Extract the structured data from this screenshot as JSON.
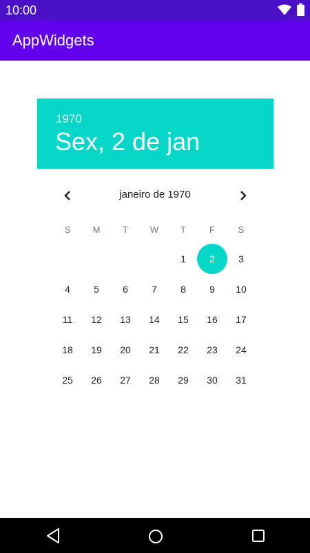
{
  "status_bar": {
    "time": "10:00",
    "icons": [
      "wifi-icon",
      "battery-icon"
    ]
  },
  "app_bar": {
    "title": "AppWidgets",
    "color": "#6200ee"
  },
  "date_picker": {
    "accent_color": "#06d6c7",
    "header": {
      "year": "1970",
      "date": "Sex, 2 de jan"
    },
    "month_label": "janeiro de 1970",
    "weekdays": [
      "S",
      "M",
      "T",
      "W",
      "T",
      "F",
      "S"
    ],
    "selected_day": "2",
    "days": [
      "",
      "",
      "",
      "",
      "1",
      "2",
      "3",
      "4",
      "5",
      "6",
      "7",
      "8",
      "9",
      "10",
      "11",
      "12",
      "13",
      "14",
      "15",
      "16",
      "17",
      "18",
      "19",
      "20",
      "21",
      "22",
      "23",
      "24",
      "25",
      "26",
      "27",
      "28",
      "29",
      "30",
      "31"
    ]
  },
  "navigation_bar": {
    "buttons": [
      "back-icon",
      "home-icon",
      "recent-apps-icon"
    ]
  }
}
